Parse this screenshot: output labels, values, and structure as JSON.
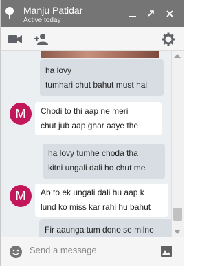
{
  "header": {
    "contact_name": "Manju Patidar",
    "status": "Active today"
  },
  "messages": [
    {
      "type": "out",
      "lines": [
        "ha lovy",
        "tumhari chut bahut must hai"
      ]
    },
    {
      "type": "in",
      "avatar": "M",
      "lines": [
        "Chodi  to  thi aap ne meri",
        "chut jub aap ghar aaye the"
      ]
    },
    {
      "type": "out",
      "lines": [
        "ha lovy tumhe  choda tha",
        "kitni ungali dali ho chut me"
      ]
    },
    {
      "type": "in",
      "avatar": "M",
      "lines": [
        "Ab to ek ungali dali hu  aap k",
        "lund ko miss kar rahi hu bahut"
      ]
    },
    {
      "type": "out",
      "lines": [
        "Fir aaunga tum dono se milne"
      ]
    }
  ],
  "composer": {
    "placeholder": "Send a message"
  },
  "colors": {
    "header_bg": "#757575",
    "avatar_bg": "#c2185b",
    "outgoing_bubble": "#d7dde2",
    "incoming_bubble": "#ffffff"
  }
}
